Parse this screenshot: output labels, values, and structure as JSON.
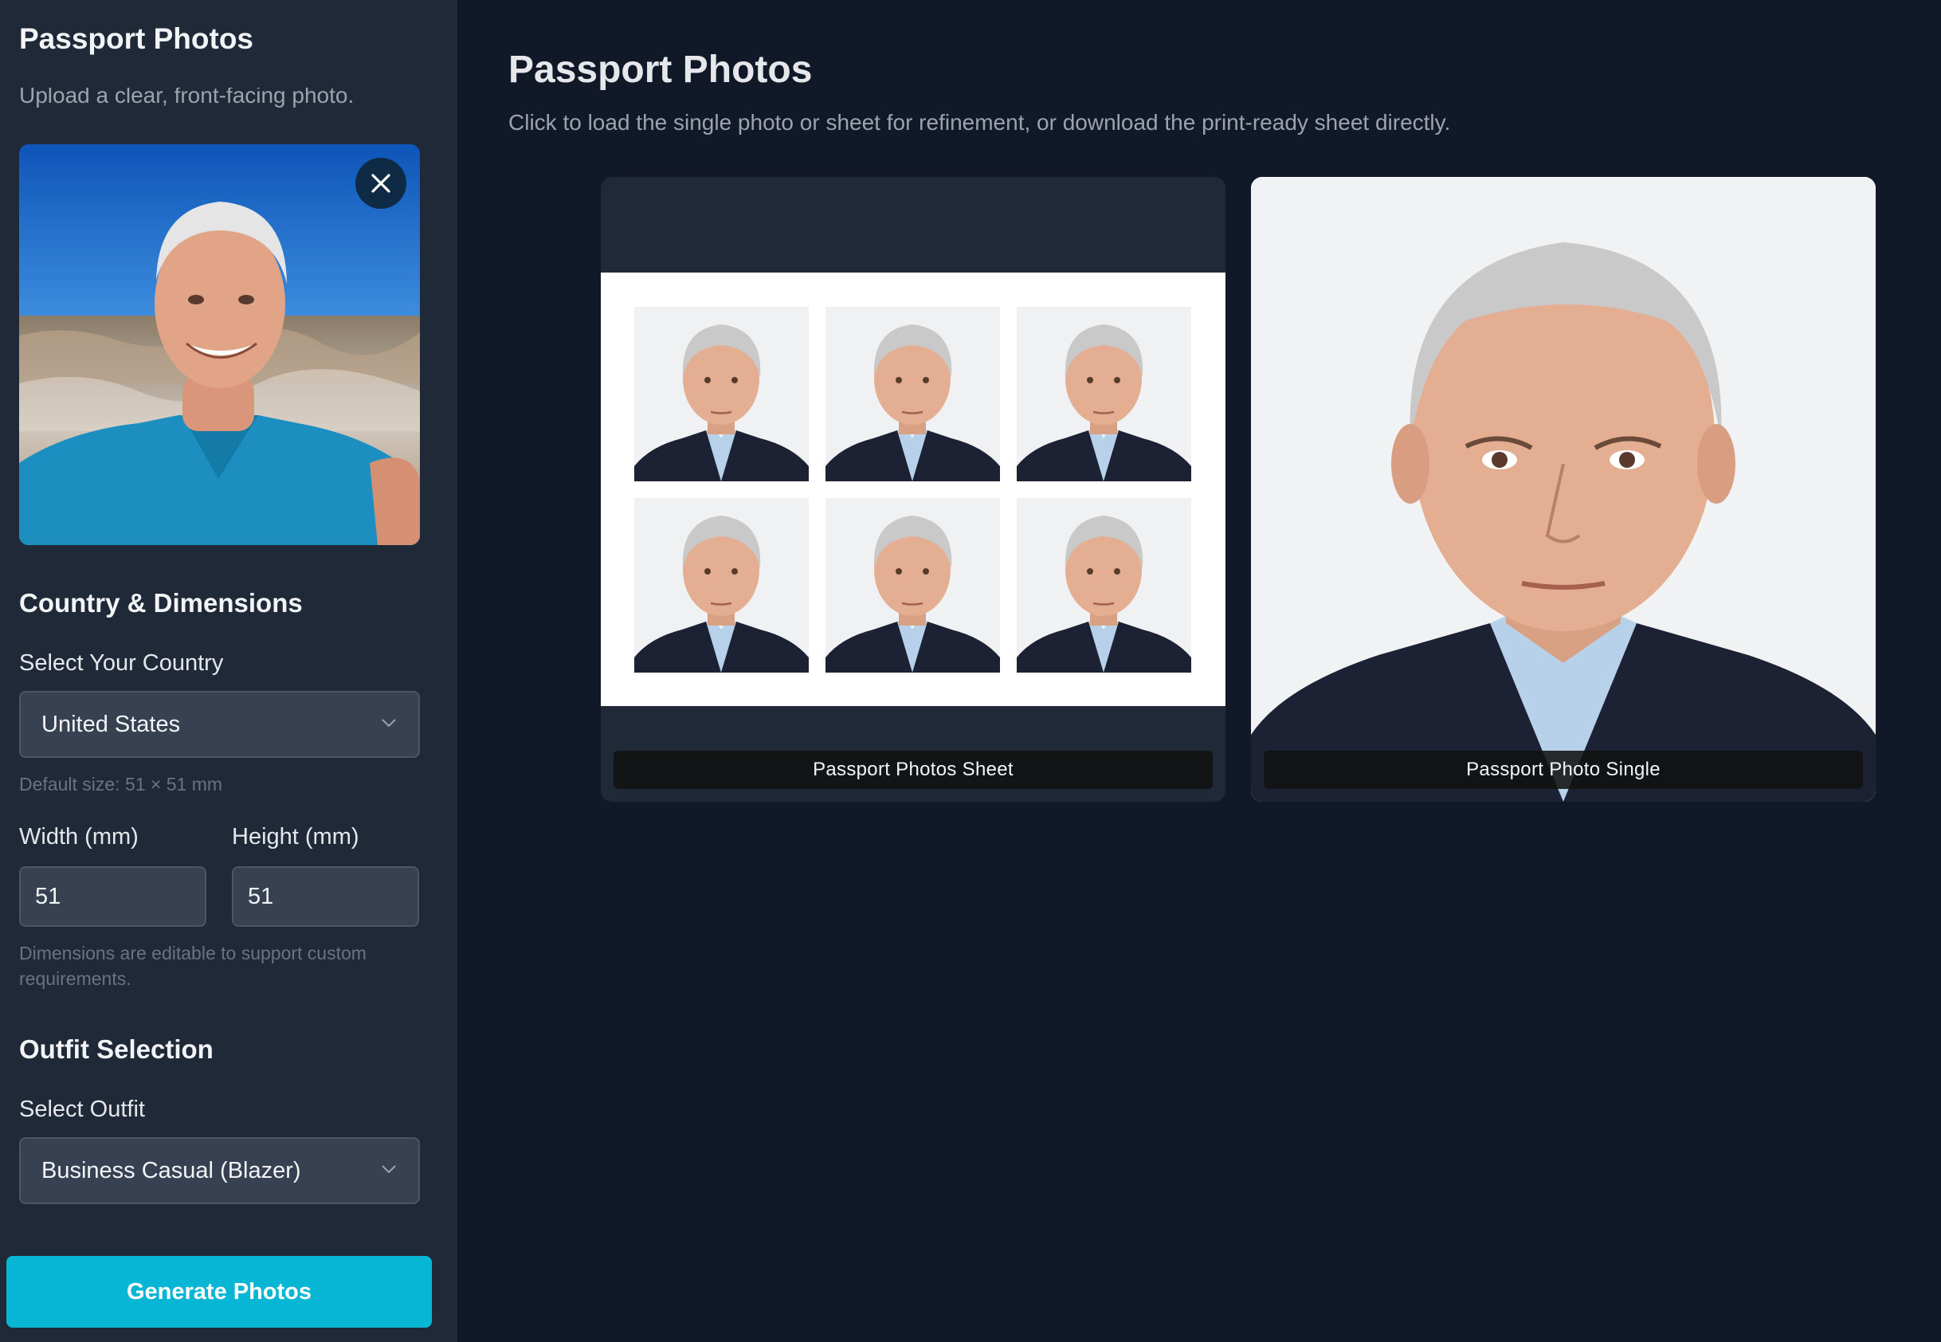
{
  "sidebar": {
    "title": "Passport Photos",
    "upload_hint": "Upload a clear, front-facing photo.",
    "country_section": {
      "heading": "Country & Dimensions",
      "select_label": "Select Your Country",
      "selected_country": "United States",
      "default_size_hint": "Default size: 51 × 51 mm",
      "width_label": "Width (mm)",
      "height_label": "Height (mm)",
      "width_value": "51",
      "height_value": "51",
      "dimensions_hint_line1": "Dimensions are editable to support custom",
      "dimensions_hint_line2": "requirements."
    },
    "outfit_section": {
      "heading": "Outfit Selection",
      "select_label": "Select Outfit",
      "selected_outfit": "Business Casual (Blazer)"
    },
    "generate_label": "Generate Photos"
  },
  "main": {
    "title": "Passport Photos",
    "subtitle": "Click to load the single photo or sheet for refinement, or download the print-ready sheet directly.",
    "results": [
      {
        "caption": "Passport Photos Sheet"
      },
      {
        "caption": "Passport Photo Single"
      }
    ]
  },
  "colors": {
    "page_bg": "#111827",
    "sidebar_bg": "#1f2937",
    "accent": "#06b6d4",
    "input_bg": "#374151"
  },
  "icons": {
    "remove_photo": "close-icon",
    "select_arrow": "chevron-down-icon"
  }
}
